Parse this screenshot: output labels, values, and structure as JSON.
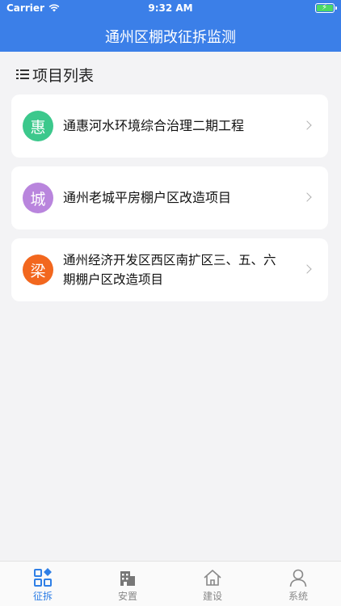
{
  "status_bar": {
    "carrier": "Carrier",
    "time": "9:32 AM"
  },
  "nav": {
    "title": "通州区棚改征拆监测"
  },
  "section": {
    "title": "项目列表"
  },
  "projects": [
    {
      "badge": "惠",
      "badge_color": "#3cc88c",
      "name": "通惠河水环境综合治理二期工程"
    },
    {
      "badge": "城",
      "badge_color": "#b985dd",
      "name": "通州老城平房棚户区改造项目"
    },
    {
      "badge": "梁",
      "badge_color": "#f2671e",
      "name": "通州经济开发区西区南扩区三、五、六期棚户区改造项目"
    }
  ],
  "tabs": [
    {
      "label": "征拆",
      "icon": "grid-icon",
      "active": true
    },
    {
      "label": "安置",
      "icon": "building-icon",
      "active": false
    },
    {
      "label": "建设",
      "icon": "home-icon",
      "active": false
    },
    {
      "label": "系统",
      "icon": "user-icon",
      "active": false
    }
  ],
  "colors": {
    "primary": "#3b7fe8",
    "active_tab": "#2f7fe6",
    "background": "#f3f3f5"
  }
}
